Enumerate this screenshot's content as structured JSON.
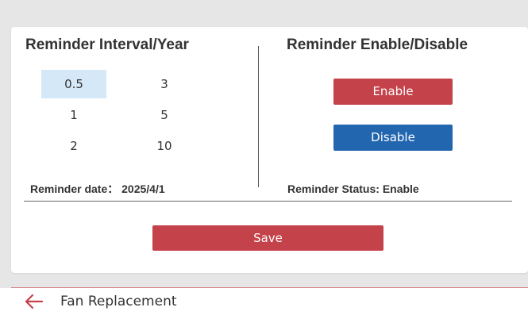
{
  "interval": {
    "title": "Reminder Interval/Year",
    "options": [
      "0.5",
      "3",
      "1",
      "5",
      "2",
      "10"
    ],
    "selected": "0.5",
    "date_label": "Reminder date：",
    "date_value": "2025/4/1"
  },
  "toggle": {
    "title": "Reminder Enable/Disable",
    "enable_label": "Enable",
    "disable_label": "Disable",
    "status_label": "Reminder Status:",
    "status_value": "Enable"
  },
  "save_label": "Save",
  "footer": {
    "back_icon": "arrow-left-icon",
    "title": "Fan Replacement"
  },
  "colors": {
    "accent_red": "#c4434a",
    "accent_blue": "#2266b0",
    "selected_bg": "#d4e8f7"
  }
}
